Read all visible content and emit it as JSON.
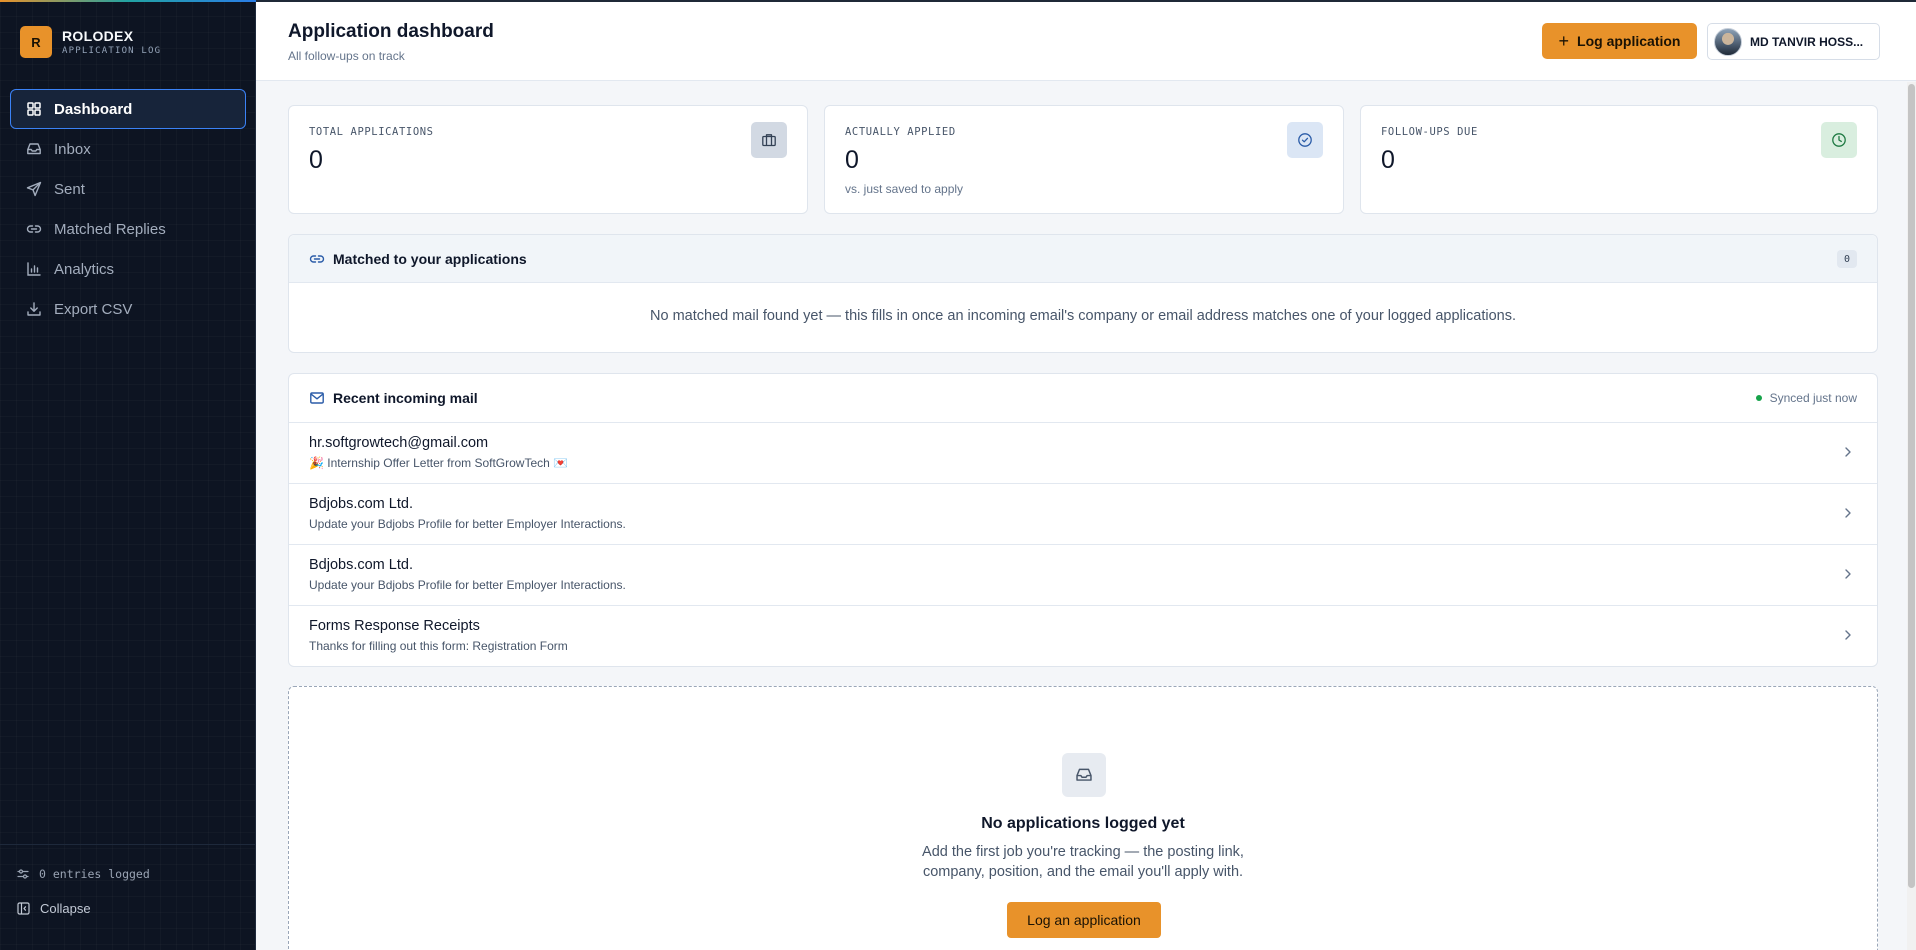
{
  "app": {
    "brand_initial": "R",
    "brand_name": "ROLODEX",
    "brand_sub": "APPLICATION LOG"
  },
  "sidebar": {
    "items": [
      {
        "label": "Dashboard",
        "icon": "dashboard-icon",
        "active": true
      },
      {
        "label": "Inbox",
        "icon": "inbox-icon"
      },
      {
        "label": "Sent",
        "icon": "send-icon"
      },
      {
        "label": "Matched Replies",
        "icon": "link-icon"
      },
      {
        "label": "Analytics",
        "icon": "bar-chart-icon"
      },
      {
        "label": "Export CSV",
        "icon": "download-icon"
      }
    ],
    "entries_text": "0 entries logged",
    "collapse_label": "Collapse"
  },
  "header": {
    "title": "Application dashboard",
    "subtitle": "All follow-ups on track",
    "log_button": "Log application",
    "user_name": "MD TANVIR HOSS..."
  },
  "stats": [
    {
      "label": "TOTAL APPLICATIONS",
      "value": "0",
      "note": "",
      "icon": "briefcase-icon"
    },
    {
      "label": "ACTUALLY APPLIED",
      "value": "0",
      "note": "vs. just saved to apply",
      "icon": "check-circle-icon"
    },
    {
      "label": "FOLLOW-UPS DUE",
      "value": "0",
      "note": "",
      "icon": "clock-icon"
    }
  ],
  "matched": {
    "title": "Matched to your applications",
    "count": "0",
    "empty": "No matched mail found yet — this fills in once an incoming email's company or email address matches one of your logged applications."
  },
  "mail": {
    "title": "Recent incoming mail",
    "sync_status": "Synced just now",
    "rows": [
      {
        "from": "hr.softgrowtech@gmail.com",
        "subject": "🎉 Internship Offer Letter from SoftGrowTech 💌"
      },
      {
        "from": "Bdjobs.com Ltd.",
        "subject": "Update your Bdjobs Profile for better Employer Interactions."
      },
      {
        "from": "Bdjobs.com Ltd.",
        "subject": "Update your Bdjobs Profile for better Employer Interactions."
      },
      {
        "from": "Forms Response Receipts",
        "subject": "Thanks for filling out this form: Registration Form"
      }
    ]
  },
  "empty_apps": {
    "title": "No applications logged yet",
    "line1": "Add the first job you're tracking — the posting link,",
    "line2": "company, position, and the email you'll apply with.",
    "button": "Log an application"
  },
  "colors": {
    "accent": "#e8922a",
    "sidebar_bg": "#0d1422",
    "active_border": "#3b82f6",
    "sync_ok": "#16a34a"
  }
}
